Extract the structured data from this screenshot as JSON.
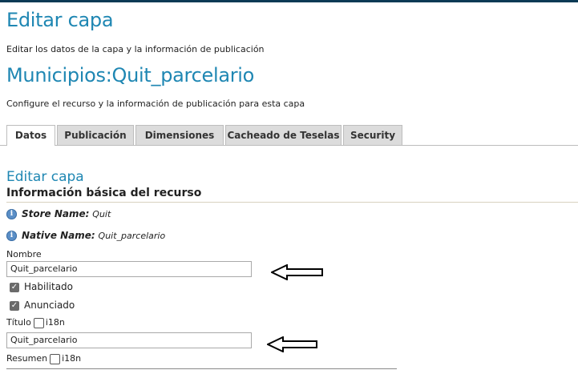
{
  "page": {
    "title": "Editar capa",
    "description": "Editar los datos de la capa y la información de publicación",
    "layer_name": "Municipios:Quit_parcelario",
    "layer_description": "Configure el recurso y la información de publicación para esta capa"
  },
  "tabs": [
    {
      "label": "Datos",
      "active": true
    },
    {
      "label": "Publicación",
      "active": false
    },
    {
      "label": "Dimensiones",
      "active": false
    },
    {
      "label": "Cacheado de Teselas",
      "active": false
    },
    {
      "label": "Security",
      "active": false
    }
  ],
  "section": {
    "title": "Editar capa",
    "subtitle": "Información básica del recurso"
  },
  "info": {
    "store_label": "Store Name:",
    "store_value": "Quit",
    "native_label": "Native Name:",
    "native_value": "Quit_parcelario"
  },
  "form": {
    "nombre_label": "Nombre",
    "nombre_value": "Quit_parcelario",
    "habilitado_label": "Habilitado",
    "habilitado_checked": true,
    "anunciado_label": "Anunciado",
    "anunciado_checked": true,
    "titulo_label": "Título",
    "titulo_i18n_label": "i18n",
    "titulo_value": "Quit_parcelario",
    "resumen_label": "Resumen",
    "resumen_i18n_label": "i18n"
  },
  "colors": {
    "heading": "#1f87b3",
    "tab_inactive": "#dcdcdc",
    "checkbox_checked": "#6b6b6b"
  },
  "icons": {
    "info": "info-icon",
    "check": "checkmark-icon",
    "arrow": "arrow-left-icon"
  }
}
